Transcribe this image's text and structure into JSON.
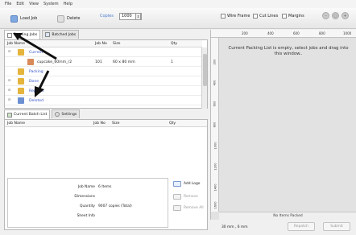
{
  "menu": [
    "File",
    "Edit",
    "View",
    "System",
    "Help"
  ],
  "toolbar": {
    "load_job": "Load Job",
    "delete": "Delete",
    "copies_label": "Copies",
    "copies_value": "1000",
    "checkboxes": [
      "Wire Frame",
      "Cut Lines",
      "Margins"
    ]
  },
  "tabs_top": [
    "Pending Jobs",
    "Batched Jobs"
  ],
  "jobs_table": {
    "headers": [
      "Job Name",
      "Job No",
      "Size",
      "Qty"
    ],
    "rows": [
      {
        "name": "Current",
        "job_no": "",
        "size": "",
        "qty": ""
      },
      {
        "name": "cupcake_60mm_r2",
        "job_no": "101",
        "size": "60 x 80 mm",
        "qty": "1"
      },
      {
        "name": "Packing",
        "job_no": "",
        "size": "",
        "qty": ""
      },
      {
        "name": "Done",
        "job_no": "",
        "size": "",
        "qty": ""
      },
      {
        "name": "Repeats",
        "job_no": "",
        "size": "",
        "qty": ""
      },
      {
        "name": "Deleted",
        "job_no": "",
        "size": "",
        "qty": ""
      }
    ]
  },
  "tabs_bottom": [
    "Current Batch List",
    "Settings"
  ],
  "batch_table": {
    "headers": [
      "Job Name",
      "Job No",
      "Size",
      "Qty"
    ]
  },
  "info": {
    "labels": [
      "Job Name",
      "Dimensions",
      "Quantity",
      "Sheet Info"
    ],
    "values": [
      "6 Items",
      "",
      "9007 copies (Total)",
      ""
    ]
  },
  "side_buttons": [
    "Add Logo",
    "Remove",
    "Remove All"
  ],
  "canvas": {
    "message": "Current Packing List is empty, select jobs and drag into this window..",
    "ruler_top": [
      "200",
      "400",
      "600",
      "800",
      "1000"
    ],
    "ruler_left": [
      "200",
      "400",
      "600",
      "800",
      "1000",
      "1200",
      "1400",
      "1600"
    ],
    "no_items": "No Items Packed"
  },
  "bottom": {
    "status": "30 mm , 6 mm",
    "repatch": "Repatch",
    "submit": "Submit"
  }
}
